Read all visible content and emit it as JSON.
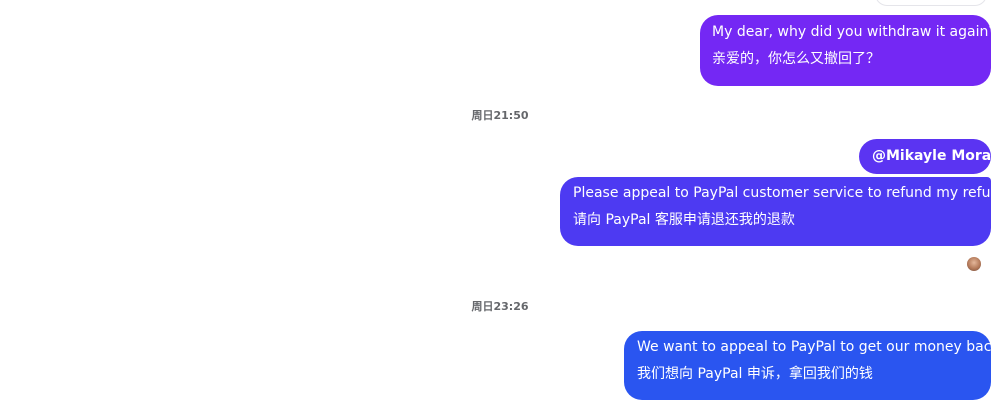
{
  "messages": [
    {
      "line1": "My dear, why did you withdraw it again?",
      "line2": "亲爱的，你怎么又撤回了？"
    },
    {
      "mention": "@Mikayle Mora"
    },
    {
      "line1": "Please appeal to PayPal customer service to refund my refund",
      "line2": "请向 PayPal 客服申请退还我的退款"
    },
    {
      "line1": "We want to appeal to PayPal to get our money back",
      "line2": "我们想向 PayPal 申诉，拿回我们的钱"
    }
  ],
  "timestamps": [
    "周日21:50",
    "周日23:26"
  ],
  "colors": {
    "bubble_purple": "#7428f4",
    "bubble_indigo": "#4d3af2",
    "bubble_blue": "#2a55f0"
  }
}
